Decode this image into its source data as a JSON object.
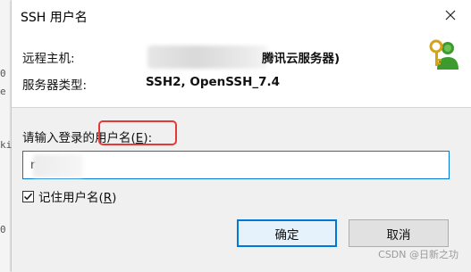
{
  "window": {
    "title": "SSH 用户名"
  },
  "background_terminal": {
    "chars": [
      "0",
      "e",
      "0",
      "ki"
    ]
  },
  "info": {
    "remote_host_label": "远程主机:",
    "remote_host_value": "腾讯云服务器)",
    "server_type_label": "服务器类型:",
    "server_type_value": "SSH2, OpenSSH_7.4"
  },
  "form": {
    "prompt_prefix": "请输入登录的用户名(",
    "prompt_accel": "E",
    "prompt_suffix": "):",
    "username_value": "r",
    "remember_prefix": "记住用户名(",
    "remember_accel": "R",
    "remember_suffix": ")",
    "remember_checked": true
  },
  "buttons": {
    "ok_label": "确定",
    "cancel_label": "取消"
  },
  "watermark": "CSDN @日新之功",
  "colors": {
    "highlight": "#e53935",
    "focus": "#0078d7"
  }
}
